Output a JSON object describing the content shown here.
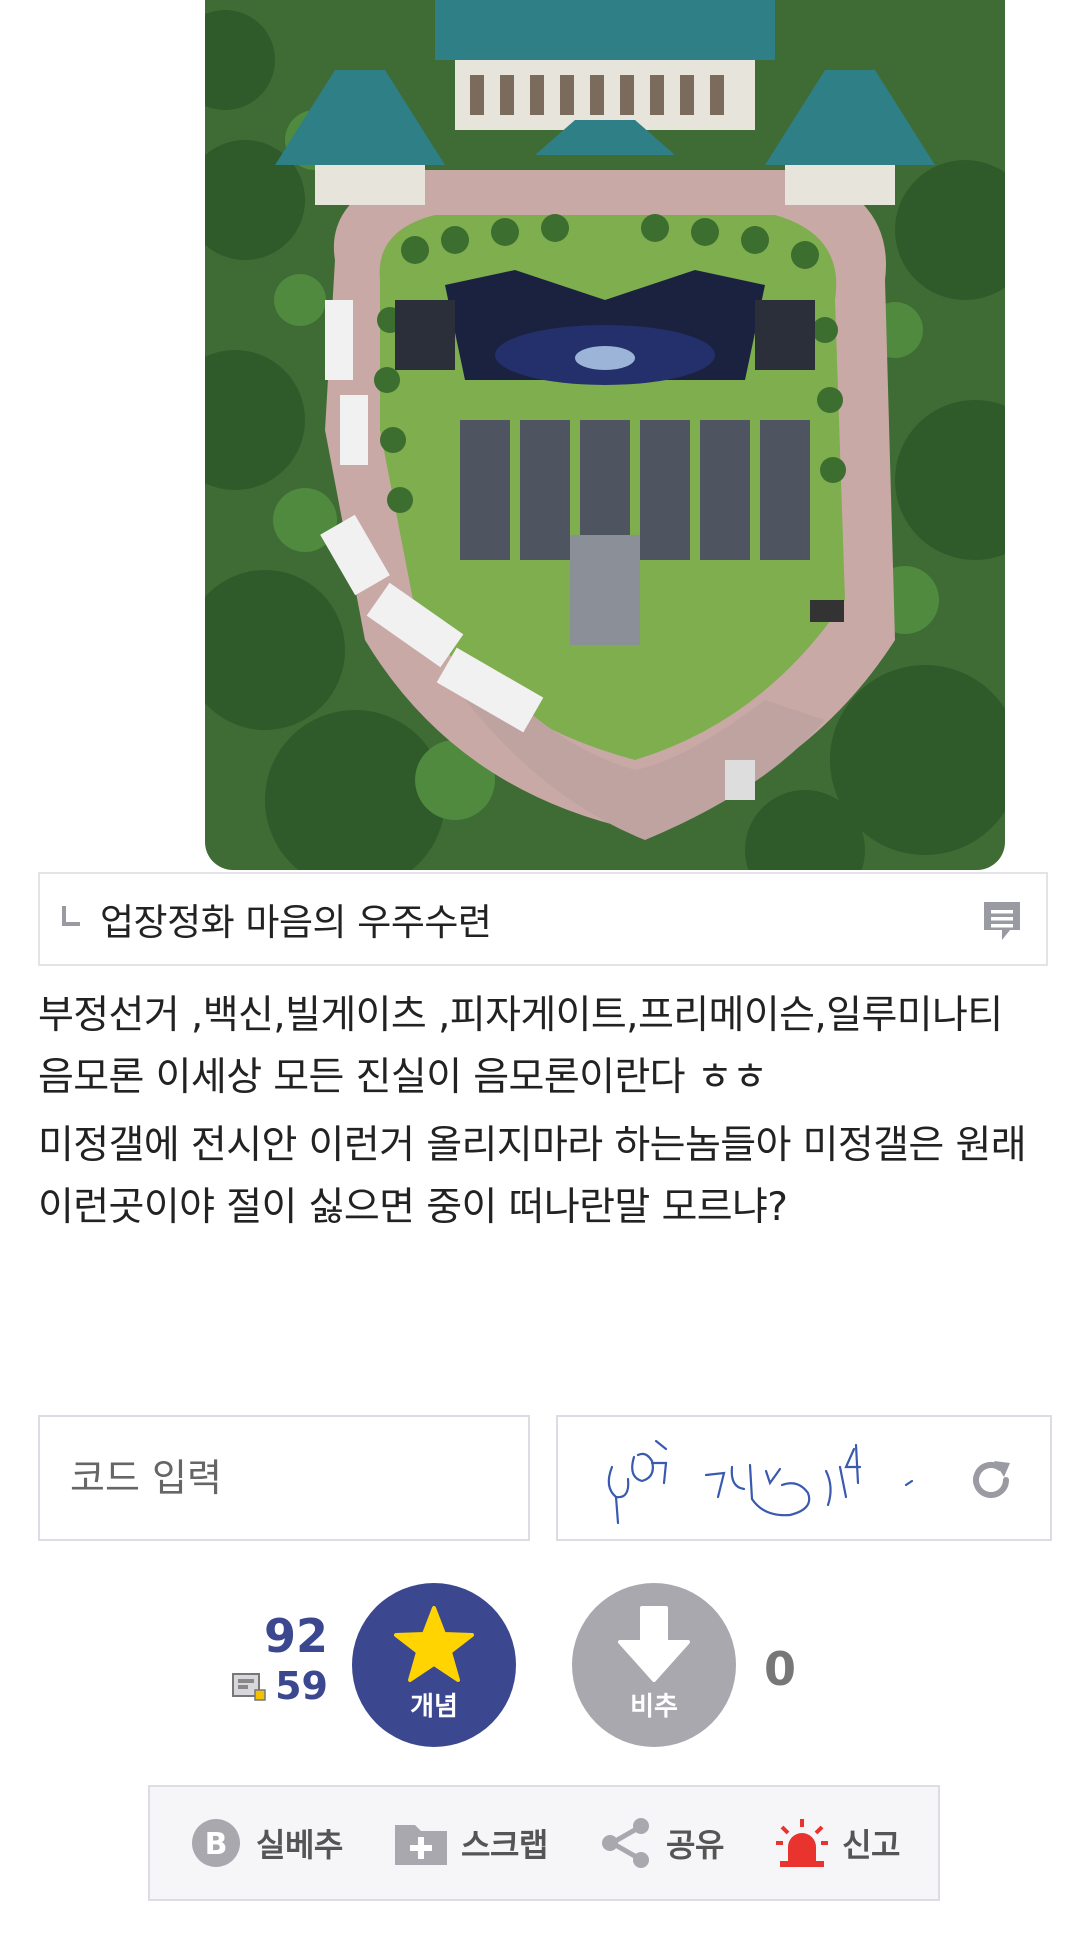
{
  "reply": {
    "text": "업장정화 마음의 우주수련"
  },
  "post": {
    "paragraphs": [
      "부정선거 ,백신,빌게이츠 ,피자게이트,프리메이슨,일루미나티 음모론 이세상 모든 진실이 음모론이란다 ㅎㅎ",
      "미정갤에 전시안 이런거 올리지마라 하는놈들아 미정갤은 원래 이런곳이야 절이 싫으면 중이 떠나란말 모르냐?"
    ]
  },
  "captcha": {
    "placeholder": "코드 입력"
  },
  "vote": {
    "up_count": "92",
    "fix_count": "59",
    "up_label": "개념",
    "down_label": "비추",
    "down_count": "0"
  },
  "actions": {
    "items": [
      {
        "label": "실베추",
        "icon": "best-b-icon"
      },
      {
        "label": "스크랩",
        "icon": "folder-plus-icon"
      },
      {
        "label": "공유",
        "icon": "share-icon"
      },
      {
        "label": "신고",
        "icon": "siren-icon"
      }
    ]
  },
  "colors": {
    "accent": "#3b4890",
    "down": "#a8a8ae",
    "report": "#e8332e",
    "star": "#ffd400"
  }
}
